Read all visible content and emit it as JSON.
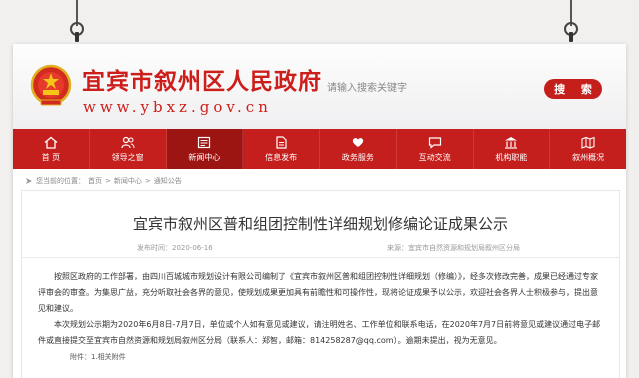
{
  "header": {
    "site_name": "宜宾市叙州区人民政府",
    "url": "www.ybxz.gov.cn",
    "search_placeholder": "请输入搜索关键字",
    "search_button": "搜 索"
  },
  "nav": {
    "items": [
      {
        "label": "首 页",
        "icon": "home-icon"
      },
      {
        "label": "领导之窗",
        "icon": "users-icon"
      },
      {
        "label": "新闻中心",
        "icon": "news-icon",
        "active": true
      },
      {
        "label": "信息发布",
        "icon": "document-icon"
      },
      {
        "label": "政务服务",
        "icon": "heart-hand-icon"
      },
      {
        "label": "互动交流",
        "icon": "chat-icon"
      },
      {
        "label": "机构职能",
        "icon": "building-icon"
      },
      {
        "label": "叙州概况",
        "icon": "map-icon"
      }
    ]
  },
  "breadcrumb": {
    "prefix": "您当前的位置：",
    "items": [
      "首页",
      "新闻中心",
      "通知公告"
    ],
    "separator": ">"
  },
  "article": {
    "title": "宜宾市叙州区普和组团控制性详细规划修编论证成果公示",
    "date": "发布时间：2020-06-16",
    "source": "来源：宜宾市自然资源和规划局叙州区分局",
    "paragraph1": "按照区政府的工作部署，由四川百城城市规划设计有限公司编制了《宜宾市叙州区普和组团控制性详细规划（修编）》，经多次修改完善，成果已经通过专家评审会的审查。为集思广益，充分听取社会各界的意见，使规划成果更加具有前瞻性和可操作性，现将论证成果予以公示，欢迎社会各界人士积极参与，提出意见和建议。",
    "paragraph2": "本次规划公示期为2020年6月8日-7月7日，单位或个人如有意见或建议，请注明姓名、工作单位和联系电话，在2020年7月7日前将意见或建议通过电子邮件或直接提交至宜宾市自然资源和规划局叙州区分局（联系人：郑智，邮箱：814258287@qq.com）。逾期未提出，视为无意见。",
    "attachment": "附件：1.相关附件"
  },
  "colors": {
    "brand_red": "#c41f1c",
    "active_nav": "#9d1513",
    "title_text": "#333333"
  }
}
